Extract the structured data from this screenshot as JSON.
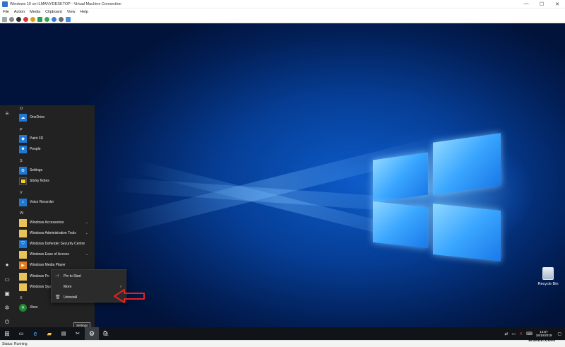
{
  "window": {
    "title": "Windows 10 on ILMANYDESKTOP - Virtual Machine Connection",
    "minimize": "—",
    "maximize": "☐",
    "close": "✕"
  },
  "menubar": [
    "File",
    "Action",
    "Media",
    "Clipboard",
    "View",
    "Help"
  ],
  "start_menu": {
    "groups": [
      {
        "letter": "O",
        "apps": [
          {
            "name": "OneDrive",
            "icon": "cloud-icon",
            "color": "#1e78d6",
            "expand": false
          }
        ]
      },
      {
        "letter": "P",
        "apps": [
          {
            "name": "Paint 3D",
            "icon": "paint-icon",
            "color": "#1e78d6",
            "expand": false
          },
          {
            "name": "People",
            "icon": "people-icon",
            "color": "#1e78d6",
            "expand": false
          }
        ]
      },
      {
        "letter": "S",
        "apps": [
          {
            "name": "Settings",
            "icon": "gear-icon",
            "color": "#1e78d6",
            "expand": false
          },
          {
            "name": "Sticky Notes",
            "icon": "note-icon",
            "color": "#2b2b2b",
            "expand": false
          }
        ]
      },
      {
        "letter": "V",
        "apps": [
          {
            "name": "Voice Recorder",
            "icon": "mic-icon",
            "color": "#1e78d6",
            "expand": false
          }
        ]
      },
      {
        "letter": "W",
        "apps": [
          {
            "name": "Windows Accessories",
            "icon": "folder-icon",
            "color": "#e8c35a",
            "expand": true
          },
          {
            "name": "Windows Administrative Tools",
            "icon": "folder-icon",
            "color": "#e8c35a",
            "expand": true
          },
          {
            "name": "Windows Defender Security Centre",
            "icon": "shield-icon",
            "color": "#1e78d6",
            "expand": false
          },
          {
            "name": "Windows Ease of Access",
            "icon": "folder-icon",
            "color": "#e8c35a",
            "expand": true
          },
          {
            "name": "Windows Media Player",
            "icon": "media-icon",
            "color": "#e07b1f",
            "expand": false
          },
          {
            "name": "Windows Po",
            "icon": "folder-icon",
            "color": "#e8c35a",
            "expand": false
          },
          {
            "name": "Windows Sys",
            "icon": "folder-icon",
            "color": "#e8c35a",
            "expand": false
          }
        ]
      },
      {
        "letter": "X",
        "apps": [
          {
            "name": "Xbox",
            "icon": "xbox-icon",
            "color": "#1f8a2f",
            "expand": false
          }
        ]
      }
    ]
  },
  "context_menu": {
    "items": [
      {
        "label": "Pin to Start",
        "icon": "pin-icon",
        "submenu": false
      },
      {
        "label": "More",
        "icon": "",
        "submenu": true
      },
      {
        "label": "Uninstall",
        "icon": "trash-icon",
        "submenu": false
      }
    ]
  },
  "tooltip": "Settings",
  "desktop": {
    "recycle_bin": "Recycle Bin"
  },
  "taskbar": {
    "time": "14:57",
    "date": "18/10/2019"
  },
  "statusbar": {
    "text": "Status: Running"
  },
  "watermark": "wsxdn.com"
}
